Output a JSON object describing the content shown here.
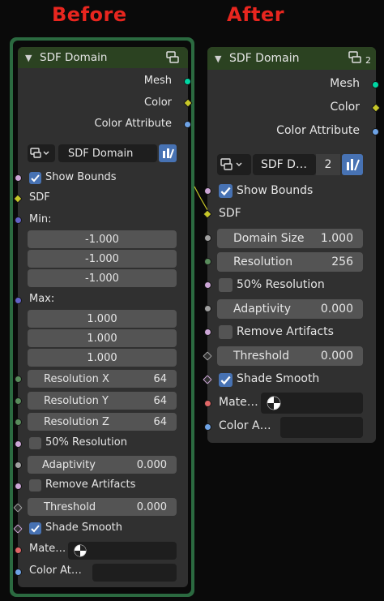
{
  "captions": {
    "before": "Before",
    "after": "After"
  },
  "colors": {
    "header_green": "#2b4221",
    "frame_green": "#2b6a40",
    "caption_red": "#e8261f",
    "socket_teal": "#00d6a3",
    "socket_yellow": "#c7c729",
    "socket_blue": "#6ea3e6",
    "socket_pink": "#cca6d6",
    "socket_grey": "#a1a1a1",
    "socket_green": "#598c5c",
    "socket_red": "#e06666",
    "socket_violet": "#6363c7",
    "checkbox_blue": "#4772b3"
  },
  "before": {
    "title": "SDF Domain",
    "outputs": [
      "Mesh",
      "Color",
      "Color Attribute"
    ],
    "datablock_name": "SDF Domain",
    "show_bounds": "Show Bounds",
    "sdf": "SDF",
    "min_label": "Min:",
    "min_values": [
      "-1.000",
      "-1.000",
      "-1.000"
    ],
    "max_label": "Max:",
    "max_values": [
      "1.000",
      "1.000",
      "1.000"
    ],
    "resolution_x": {
      "label": "Resolution X",
      "value": "64"
    },
    "resolution_y": {
      "label": "Resolution Y",
      "value": "64"
    },
    "resolution_z": {
      "label": "Resolution Z",
      "value": "64"
    },
    "half_resolution": "50% Resolution",
    "adaptivity": {
      "label": "Adaptivity",
      "value": "0.000"
    },
    "remove_artifacts": "Remove Artifacts",
    "threshold": {
      "label": "Threshold",
      "value": "0.000"
    },
    "shade_smooth": "Shade Smooth",
    "material": "Mate…",
    "color_attribute": "Color At…"
  },
  "after": {
    "title": "SDF Domain",
    "user_count": "2",
    "outputs": [
      "Mesh",
      "Color",
      "Color Attribute"
    ],
    "datablock_name": "SDF D…",
    "datablock_users": "2",
    "show_bounds": "Show Bounds",
    "sdf": "SDF",
    "domain_size": {
      "label": "Domain Size",
      "value": "1.000"
    },
    "resolution": {
      "label": "Resolution",
      "value": "256"
    },
    "half_resolution": "50% Resolution",
    "adaptivity": {
      "label": "Adaptivity",
      "value": "0.000"
    },
    "remove_artifacts": "Remove Artifacts",
    "threshold": {
      "label": "Threshold",
      "value": "0.000"
    },
    "shade_smooth": "Shade Smooth",
    "material": "Mate…",
    "color_attribute": "Color A…"
  }
}
